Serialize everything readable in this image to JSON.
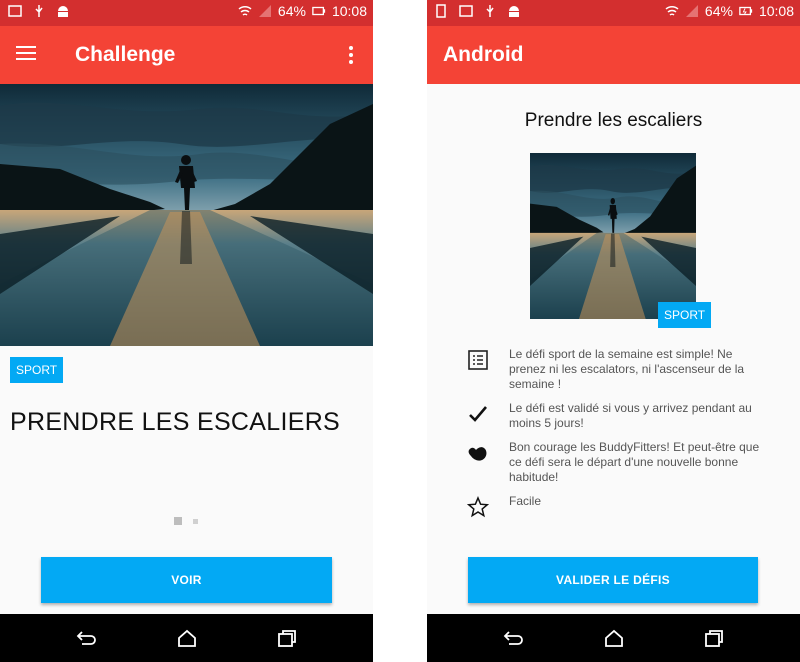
{
  "status_bar": {
    "battery": "64%",
    "time": "10:08"
  },
  "left_screen": {
    "app_title": "Challenge",
    "badge": "SPORT",
    "title": "PRENDRE LES ESCALIERS",
    "button_label": "VOIR"
  },
  "right_screen": {
    "app_title": "Android",
    "title": "Prendre les escaliers",
    "badge": "SPORT",
    "items": [
      {
        "icon": "list-icon",
        "text": "Le défi sport de la semaine est simple! Ne prenez ni les escalators, ni l'ascenseur de la semaine !"
      },
      {
        "icon": "check-icon",
        "text": "Le défi est validé si vous y arrivez pendant au moins 5 jours!"
      },
      {
        "icon": "muscle-icon",
        "text": "Bon courage les BuddyFitters! Et peut-être que ce défi sera le départ d'une nouvelle bonne habitude!"
      },
      {
        "icon": "star-icon",
        "text": "Facile"
      }
    ],
    "button_label": "VALIDER LE DÉFIS"
  },
  "colors": {
    "status_bar": "#d32f2f",
    "app_bar": "#f44336",
    "accent": "#03a9f4",
    "nav_bar": "#000000"
  }
}
